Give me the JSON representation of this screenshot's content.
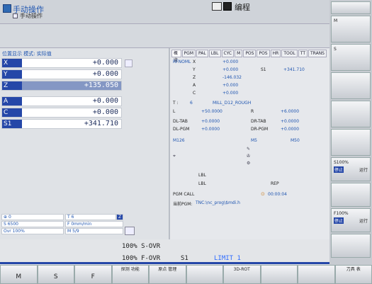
{
  "header": {
    "mode_title": "手动操作",
    "mode_subtitle": "手动操作",
    "prog_title": "编程"
  },
  "positions": {
    "title": "位置显示 模式: 实际值",
    "axes": [
      {
        "name": "X",
        "value": "+0.000"
      },
      {
        "name": "Y",
        "value": "+0.000"
      },
      {
        "name": "Z",
        "value": "+135.050"
      },
      {
        "name": "A",
        "value": "+0.000"
      },
      {
        "name": "C",
        "value": "+0.000"
      },
      {
        "name": "S1",
        "value": "+341.710"
      }
    ]
  },
  "status": {
    "c1": "0",
    "c2": "T 6",
    "c3": "Z",
    "c4": "S 6500",
    "c5": "F 0mm/min",
    "c6": "Ovr 100%",
    "c7": "M 5/9"
  },
  "tabs": [
    "概览",
    "PGM",
    "PAL",
    "LBL",
    "CYC",
    "M",
    "POS",
    "POS",
    "HR",
    "TOOL",
    "TT",
    "TRANS"
  ],
  "rf": {
    "label": "RFNOML",
    "rows": [
      {
        "k": "X",
        "v": "+0.000",
        "k2": "",
        "v2": ""
      },
      {
        "k": "Y",
        "v": "+0.000",
        "k2": "S1",
        "v2": "+341.710"
      },
      {
        "k": "Z",
        "v": "-146.032",
        "k2": "",
        "v2": ""
      },
      {
        "k": "A",
        "v": "+0.000",
        "k2": "",
        "v2": ""
      },
      {
        "k": "C",
        "v": "+0.000",
        "k2": "",
        "v2": ""
      }
    ]
  },
  "tool": {
    "t_label": "T :",
    "t_num": "6",
    "t_name": "MILL_D12_ROUGH",
    "l_label": "L",
    "l_val": "+50.0000",
    "r_label": "R",
    "r_val": "+6.0000",
    "dltab": "DL-TAB",
    "dltab_v": "+0.0000",
    "drtab": "DR-TAB",
    "drtab_v": "+0.0000",
    "dlpgm": "DL-PGM",
    "dlpgm_v": "+0.0000",
    "drpgm": "DR-PGM",
    "drpgm_v": "+0.0000"
  },
  "m": {
    "m126": "M126",
    "m5": "M5",
    "m50": "M50"
  },
  "lbl": {
    "lbl1": "LBL",
    "lbl2": "LBL",
    "rep": "REP"
  },
  "pgmcall": {
    "label": "PGM CALL",
    "time": "00:00:04"
  },
  "current_pgm": {
    "label": "当前PGM:",
    "path": "TNC:\\nc_prog\\$mdi.h"
  },
  "override": {
    "s_ovr": "100% S-OVR",
    "f_ovr": "100% F-OVR",
    "spindle": "S1",
    "limit": "LIMIT 1"
  },
  "softkeys": [
    {
      "top": "",
      "label": "M"
    },
    {
      "top": "",
      "label": "S"
    },
    {
      "top": "",
      "label": "F"
    },
    {
      "top": "探测\n功能",
      "label": ""
    },
    {
      "top": "原点\n管理",
      "label": ""
    },
    {
      "top": "",
      "label": ""
    },
    {
      "top": "3D-ROT",
      "label": ""
    },
    {
      "top": "",
      "label": ""
    },
    {
      "top": "",
      "label": ""
    },
    {
      "top": "刀具\n表",
      "label": ""
    }
  ],
  "vkeys": {
    "m": "M",
    "s": "S",
    "s100": "S100%",
    "run1": "运行",
    "f100": "F100%",
    "run2": "运行",
    "stop": "停止"
  }
}
